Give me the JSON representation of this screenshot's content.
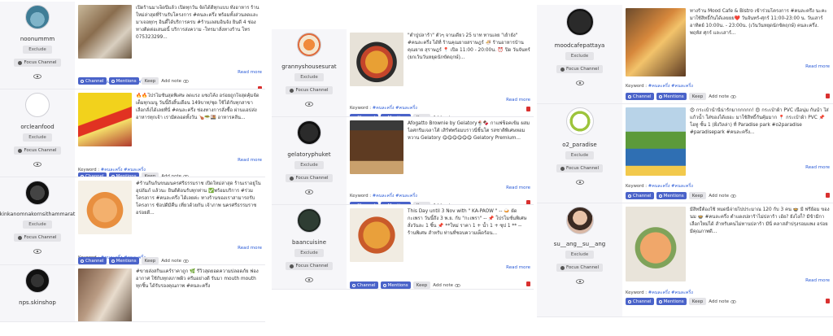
{
  "ui": {
    "exclude_label": "Exclude",
    "focus_channel_label": "Focus Channel",
    "read_more_label": "Read more",
    "keyword_label": "Keyword :",
    "channel_label": "Channel",
    "mentions_label": "Mentions",
    "keep_label": "Keep",
    "add_note_label": "Add note"
  },
  "colors": {
    "accent": "#4a63c9",
    "link": "#2a5bd7",
    "danger": "#d9302f",
    "panel": "#f6f6f9"
  },
  "columns": [
    {
      "cards": [
        {
          "username": "noonummm",
          "text": "เปิดร้านมาเจ็ดปีแล้ว เปิดทุกวัน จัดได้ดีทุกแบบ ทั้งอาหาร ร้านใหม่ล่าสุดที่ร้านรับโครงการ #คนละครึ่ง พร้อมทั้งส่วนลดและ มาเจอทุกๆ อินดี้ได้บริการครบ #ร้านเลสมอินจัง ยินดี 4 ช่องทางติดต่อเสนอนี้ บริการส่งความ -โทรมาสั่งทางร้าน โทร 075323299...",
          "keyword": "#คนละครึ่ง #คนละครึ่ง"
        },
        {
          "username": "orcleanfood",
          "text": "🔥🔥โปรโมชั่นสุดพิเศษ ลดแรง แซงโค้ง อร่อยถูกใจสุดคุ้มจัดเต็มทุกเมนู วันนี้ถึงสิ้นเดือน 149บาท/ชุด ใช้ได้กับทุกสาขา เลือกสั่งได้เลยที่นี่ #คนละครึ่ง ช่องทางการสั่งซื้อ ผ่านแอปส่งอาหารทุกเจ้า เรามีตลอดทั้งวัน 🍗🥗🍱 อาหารคลีน...",
          "keyword": "#คนละครึ่ง #คนละครึ่ง"
        },
        {
          "username": "kinkanomnakornsithammarat",
          "text": "#ร้านกินกันขนมนครศรีธรรมราช เปิดใหม่ล่าสุด ร้านเราอยู่ใน อุปถัมภ์ แล้วนะ ยินดีต้อนรับทุกท่าน ✅พร้อมบริการ #ร่วมโครงการ #คนละครึ่ง ได้เลยค่ะ ทางร้านของเราสามารถรับโครงการ ช้อปดีมีคืน เที่ยวด้วยกัน เจ้าภาพ นครศรีธรรมราช อร่อยดี...",
          "keyword": "#คนละครึ่ง #คนละครึ่ง"
        },
        {
          "username": "nps.skinshop",
          "text": "#ขายส่งสกินแคร์ราคาถูก 🌿 รีวิวสุดยอดความปลอดภัย ฟองอากาศ ใช้กับทุกสภาพผิว ครีมอย่างดี รับมา mouth mouth ทุกชิ้น ได้รับรองคุณภาพ #คนละครึ่ง",
          "keyword": ""
        }
      ]
    },
    {
      "cards": [
        {
          "username": "grannyshousesurat",
          "text": "\"ตำปูปลาร้า\" ตัวๆ จานเดียว 25 บาท ทานเลย \"เย้ายัง\" #คนละครึ่ง ได้ที่ ร้านคุณยายสราษฎร์ 🍜 ร้านอาหารบ้านคุณยาย สุราษฎร์ 📍 เปิด 11:00 - 20:00น. ⏰ ปิด วันจันทร์ (ยกเว้นวันหยุดนักขัตฤกษ์)...",
          "keyword": "#คนละครึ่ง #คนละครึ่ง"
        },
        {
          "username": "gelatoryphuket",
          "text": "Afogatto Brownie by Gelatory🍨🍫 กาแฟช็อคเข้ม ผสมไอศกรีมเจลาโต้ เสิร์ฟพร้อมบราวนี่ชิ้นโต รสชาติพิเศษหอมหวาน Gelatory 😋😋😋😋😋😋 Gelatory Premium...",
          "keyword": "#คนละครึ่ง #คนละครึ่ง"
        },
        {
          "username": "baancuisine",
          "text": "This Day until 3 Nov with \" KA-PAOW \" -- 🍛 ผัดกะเพรา วันนี้ถึง 3 พ.ย. กับ \"กะเพรา\" -- 📌 โปรโมชั่นพิเศษ สั่งวันละ 1 ชิ้น 📌 **ใหม่ ราคา 1 + น้ำ 1 + ซุป 1 ** -- ร้านพิเศษ สำหรับ ท่านที่ชอบความเผ็ดร้อน...",
          "keyword": ""
        }
      ]
    },
    {
      "cards": [
        {
          "username": "moodcafepattaya",
          "text": "ทางร้าน Mood Cafe & Bistro เข้าร่วมโครงการ #คนละครึ่ง นะคะ มาใช้สิทธิ์กันได้เลยยย❤️ วันจันทร์-ศุกร์ 11:00-23:00 น. วันเสาร์ อาทิตย์ 10:00น. - 23:00น. (เว้นวันหยุดนักขัตฤกษ์) คนละครึ่ง. พฤหัส ศุกร์ และเสาร์...",
          "keyword": "#คนละครึ่ง #คนละครึ่ง"
        },
        {
          "username": "o2_paradise",
          "text": "😍 กระเป๋าน้ำนี้น่ารักมากกกกก! 😍 กระเป๋าผ้า PVC เนื้อนุ่ม กันน้ำ ใส่แก้วน้ำ ใส่ของได้เยอะ มาใช้สิทธิ์กันคุ้มมาก 📍 กระเป๋าผ้า PVC 📌 โอทู ชั้น 1 (ฝั่งวิลล่า) ที่ Paradise park #o2paradise #paradisepark #คนละครึ่ง...",
          "keyword": "#คนละครึ่ง #คนละครึ่ง"
        },
        {
          "username": "su__ang__su__ang",
          "text": "มีสิทธิ์ต้องใช้ หมดนี้จ่ายไปประมาณ 120 กับ 3 คน 🍲 มี ฟรีย้อม ของนม 🍲 #คนละครึ่ง ตำแดงปลาร้าไม่ปลาร้า เอ้ย? ยังไงก็? มีข้ามีกาเลือกใหม่ได้ สำหรับคนไม่ทานปลาร้า มีนี่ คลาสสำปรุงรอมแพง อร่อยมีคุณภาพดี...",
          "keyword": "#คนละครึ่ง #คนละครึ่ง"
        }
      ]
    }
  ]
}
